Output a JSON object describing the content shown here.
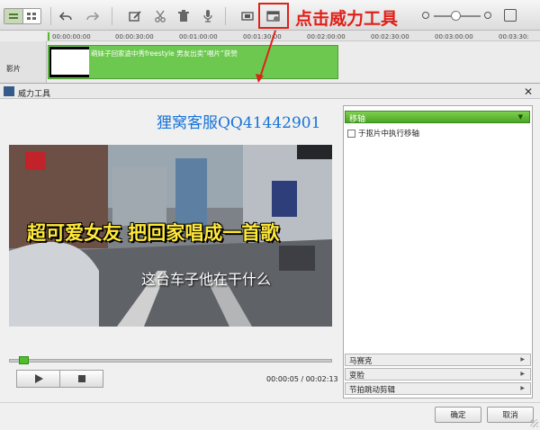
{
  "toolbar": {
    "annotation": "点击威力工具"
  },
  "timeline": {
    "ticks": [
      "00:00:00:00",
      "00:00:30:00",
      "00:01:00:00",
      "00:01:30:00",
      "00:02:00:00",
      "00:02:30:00",
      "00:03:00:00",
      "00:03:30:"
    ],
    "track_label": "影片",
    "clip_title": "萌妹子回家途中秀freestyle 男友出卖“唱片”获赞"
  },
  "dialog": {
    "title": "威力工具",
    "watermark": "狸窝客服QQ41442901",
    "video": {
      "caption_main": "超可爱女友 把回家唱成一首歌",
      "caption_sub": "这台车子他在干什么"
    },
    "playback": {
      "time_display": "00:00:05 / 00:02:13",
      "progress_fraction": 0.04
    },
    "effects": {
      "selected": "移轴",
      "checkbox_label": "于抠片中执行移轴",
      "checkbox_checked": false,
      "other_effects": [
        "马赛克",
        "变脸",
        "节拍跳动剪辑"
      ]
    },
    "buttons": {
      "ok": "确定",
      "cancel": "取消"
    }
  },
  "colors": {
    "accent_green": "#6dc850",
    "annotation_red": "#e0201a",
    "watermark_blue": "#1773d9",
    "caption_yellow": "#ffe93a"
  }
}
